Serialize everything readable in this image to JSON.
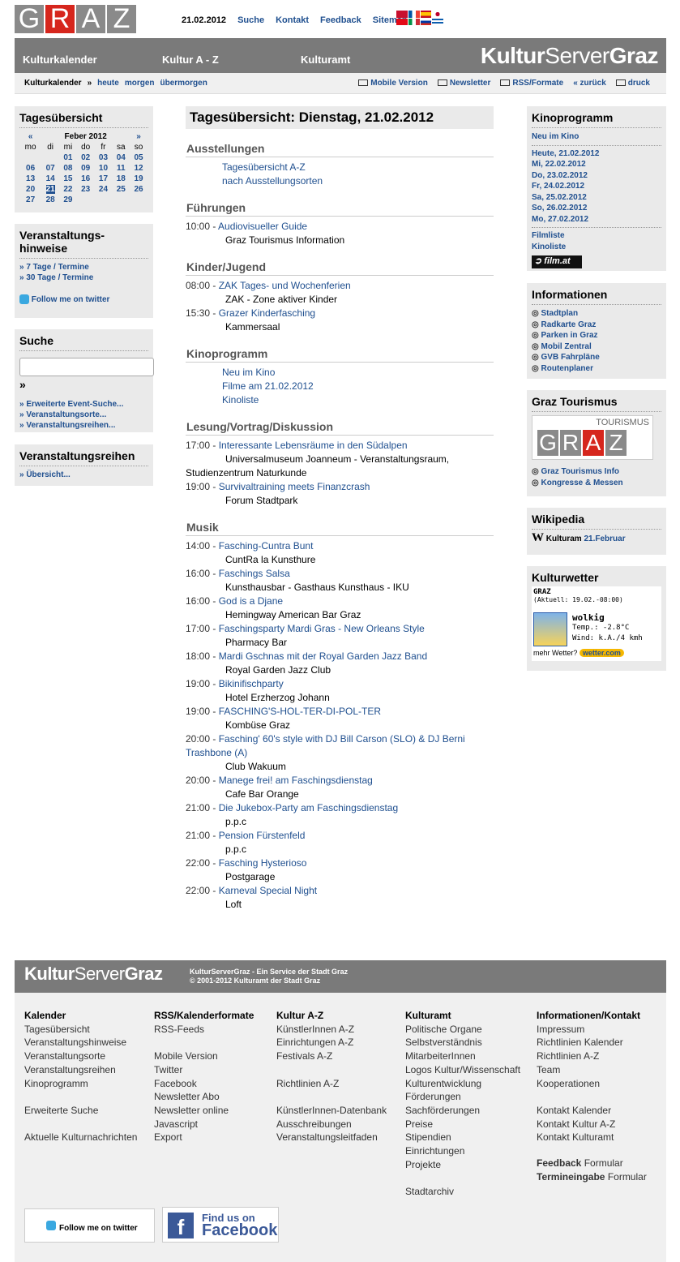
{
  "header": {
    "logo_letters": [
      "G",
      "R",
      "A",
      "Z"
    ],
    "date": "21.02.2012",
    "links": [
      "Suche",
      "Kontakt",
      "Feedback",
      "Sitemap"
    ]
  },
  "bar": {
    "items": [
      "Kulturkalender",
      "Kultur A - Z",
      "Kulturamt"
    ],
    "brand_a": "Kultur",
    "brand_b": "Server",
    "brand_c": "Graz"
  },
  "subnav": {
    "label": "Kulturkalender",
    "sep": "»",
    "links": [
      "heute",
      "morgen",
      "übermorgen"
    ],
    "right": [
      "Mobile Version",
      "Newsletter",
      "RSS/Formate",
      "zurück",
      "druck"
    ]
  },
  "left": {
    "tages": {
      "title": "Tagesübersicht",
      "prev": "«",
      "month": "Feber 2012",
      "next": "»",
      "days": [
        "mo",
        "di",
        "mi",
        "do",
        "fr",
        "sa",
        "so"
      ],
      "weeks": [
        [
          "",
          "",
          "01",
          "02",
          "03",
          "04",
          "05"
        ],
        [
          "06",
          "07",
          "08",
          "09",
          "10",
          "11",
          "12"
        ],
        [
          "13",
          "14",
          "15",
          "16",
          "17",
          "18",
          "19"
        ],
        [
          "20",
          "21",
          "22",
          "23",
          "24",
          "25",
          "26"
        ],
        [
          "27",
          "28",
          "29",
          "",
          "",
          "",
          ""
        ]
      ]
    },
    "hinweise": {
      "title1": "Veranstaltungs-",
      "title2": "hinweise",
      "links": [
        "» 7 Tage / Termine",
        "» 30 Tage / Termine"
      ],
      "twitter": "Follow me on twitter"
    },
    "suche": {
      "title": "Suche",
      "go": "»",
      "links": [
        "» Erweiterte Event-Suche...",
        "» Veranstaltungsorte...",
        "» Veranstaltungsreihen..."
      ]
    },
    "reihen": {
      "title": "Veranstaltungsreihen",
      "links": [
        "» Übersicht..."
      ]
    }
  },
  "main": {
    "title": "Tagesübersicht: Dienstag, 21.02.2012",
    "ausstellungen": {
      "title": "Ausstellungen",
      "links": [
        "Tagesübersicht A-Z",
        "nach Ausstellungsorten"
      ]
    },
    "fuehrungen": {
      "title": "Führungen",
      "events": [
        {
          "time": "10:00 -",
          "name": "Audiovisueller Guide",
          "loc": "Graz Tourismus Information"
        }
      ]
    },
    "kinder": {
      "title": "Kinder/Jugend",
      "events": [
        {
          "time": "08:00 -",
          "name": "ZAK Tages- und Wochenferien",
          "loc": "ZAK - Zone aktiver Kinder"
        },
        {
          "time": "15:30 -",
          "name": "Grazer Kinderfasching",
          "loc": "Kammersaal"
        }
      ]
    },
    "kino": {
      "title": "Kinoprogramm",
      "links": [
        "Neu im Kino",
        "Filme am 21.02.2012",
        "Kinoliste"
      ]
    },
    "lesung": {
      "title": "Lesung/Vortrag/Diskussion",
      "events": [
        {
          "time": "17:00 -",
          "name": "Interessante Lebensräume in den Südalpen",
          "loc": "Universalmuseum Joanneum - Veranstaltungsraum,",
          "loc2": "Studienzentrum Naturkunde"
        },
        {
          "time": "19:00 -",
          "name": "Survivaltraining meets Finanzcrash",
          "loc": "Forum Stadtpark"
        }
      ]
    },
    "musik": {
      "title": "Musik",
      "events": [
        {
          "time": "14:00 -",
          "name": "Fasching-Cuntra Bunt",
          "loc": "CuntRa la Kunsthure"
        },
        {
          "time": "16:00 -",
          "name": "Faschings Salsa",
          "loc": "Kunsthausbar - Gasthaus Kunsthaus - IKU"
        },
        {
          "time": "16:00 -",
          "name": "God is a Djane",
          "loc": "Hemingway American Bar Graz"
        },
        {
          "time": "17:00 -",
          "name": "Faschingsparty Mardi Gras - New Orleans Style",
          "loc": "Pharmacy Bar"
        },
        {
          "time": "18:00 -",
          "name": "Mardi Gschnas mit der Royal Garden Jazz Band",
          "loc": "Royal Garden Jazz Club"
        },
        {
          "time": "19:00 -",
          "name": "Bikinifischparty",
          "loc": "Hotel Erzherzog Johann"
        },
        {
          "time": "19:00 -",
          "name": "FASCHING'S-HOL-TER-DI-POL-TER",
          "loc": "Kombüse Graz"
        },
        {
          "time": "20:00 -",
          "name": "Fasching' 60's style with DJ Bill Carson (SLO) & DJ Berni",
          "name2": "Trashbone (A)",
          "loc": "Club Wakuum"
        },
        {
          "time": "20:00 -",
          "name": "Manege frei! am Faschingsdienstag",
          "loc": "Cafe Bar Orange"
        },
        {
          "time": "21:00 -",
          "name": "Die Jukebox-Party am Faschingsdienstag",
          "loc": "p.p.c"
        },
        {
          "time": "21:00 -",
          "name": "Pension Fürstenfeld",
          "loc": "p.p.c"
        },
        {
          "time": "22:00 -",
          "name": "Fasching Hysterioso",
          "loc": "Postgarage"
        },
        {
          "time": "22:00 -",
          "name": "Karneval Special Night",
          "loc": "Loft"
        }
      ]
    }
  },
  "right": {
    "kino": {
      "title": "Kinoprogramm",
      "new": "Neu im Kino",
      "days": [
        "Heute, 21.02.2012",
        "Mi, 22.02.2012",
        "Do, 23.02.2012",
        "Fr, 24.02.2012",
        "Sa, 25.02.2012",
        "So, 26.02.2012",
        "Mo, 27.02.2012"
      ],
      "filmliste": "Filmliste",
      "kinoliste": "Kinoliste",
      "filmat": "film.at"
    },
    "info": {
      "title": "Informationen",
      "links": [
        "Stadtplan",
        "Radkarte Graz",
        "Parken in Graz",
        "Mobil Zentral",
        "GVB Fahrpläne",
        "Routenplaner"
      ]
    },
    "tourismus": {
      "title": "Graz Tourismus",
      "logo_top": "TOURISMUS",
      "logo_letters": [
        "G",
        "R",
        "A",
        "Z"
      ],
      "links": [
        "Graz Tourismus Info",
        "Kongresse & Messen"
      ]
    },
    "wiki": {
      "title": "Wikipedia",
      "w": "W",
      "text": "Kulturam",
      "link": "21.Februar"
    },
    "wetter": {
      "title": "Kulturwetter",
      "city": "GRAZ",
      "aktuell": "(Aktuell: 19.02.-08:00)",
      "cond": "wolkig",
      "temp": "Temp.: -2.8°C",
      "wind": "Wind: k.A./4 kmh",
      "mehr": "mehr Wetter?",
      "badge": "wetter.com"
    }
  },
  "footer": {
    "brand_a": "Kultur",
    "brand_b": "Server",
    "brand_c": "Graz",
    "line1": "KulturServerGraz - Ein Service der Stadt Graz",
    "line2": "© 2001-2012 Kulturamt der Stadt Graz",
    "cols": [
      {
        "title": "Kalender",
        "items": [
          "Tagesübersicht",
          "Veranstaltungshinweise",
          "Veranstaltungsorte",
          "Veranstaltungsreihen",
          "Kinoprogramm",
          "",
          "Erweiterte Suche",
          "",
          "Aktuelle Kulturnachrichten"
        ]
      },
      {
        "title": "RSS/Kalenderformate",
        "items": [
          "RSS-Feeds",
          "",
          "Mobile Version",
          "Twitter",
          "Facebook",
          "Newsletter Abo",
          "Newsletter online",
          "Javascript",
          "Export"
        ]
      },
      {
        "title": "Kultur A-Z",
        "items": [
          "KünstlerInnen A-Z",
          "Einrichtungen A-Z",
          "Festivals A-Z",
          "",
          "Richtlinien A-Z",
          "",
          "KünstlerInnen-Datenbank",
          "Ausschreibungen",
          "Veranstaltungsleitfaden"
        ]
      },
      {
        "title": "Kulturamt",
        "items": [
          "Politische Organe",
          "Selbstverständnis",
          "MitarbeiterInnen",
          "Logos Kultur/Wissenschaft",
          "Kulturentwicklung",
          "Förderungen",
          "Sachförderungen",
          "Preise",
          "Stipendien",
          "Einrichtungen",
          "Projekte",
          "",
          "Stadtarchiv"
        ]
      },
      {
        "title": "Informationen/Kontakt",
        "items": [
          "Impressum",
          "Richtlinien Kalender",
          "Richtlinien A-Z",
          "Team",
          "Kooperationen",
          "",
          "Kontakt Kalender",
          "Kontakt Kultur A-Z",
          "Kontakt Kulturamt"
        ]
      }
    ],
    "feedback_b": "Feedback",
    "feedback_t": "Formular",
    "termin_b": "Termineingabe",
    "termin_t": "Formular",
    "twitter": "Follow me on twitter",
    "fb1": "Find us on",
    "fb2": "Facebook",
    "fbf": "f"
  }
}
